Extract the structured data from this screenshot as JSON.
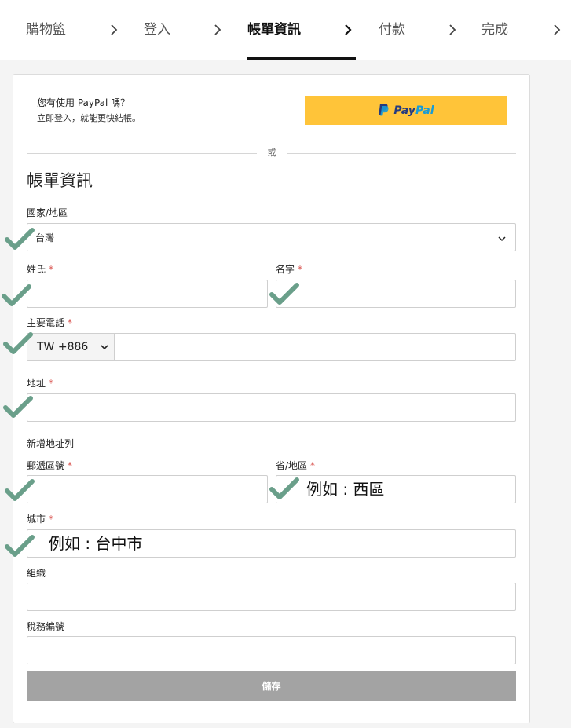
{
  "steps": [
    {
      "label": "購物籃",
      "active": false
    },
    {
      "label": "登入",
      "active": false
    },
    {
      "label": "帳單資訊",
      "active": true
    },
    {
      "label": "付款",
      "active": false
    },
    {
      "label": "完成",
      "active": false
    }
  ],
  "paypal": {
    "question": "您有使用 PayPal 嗎？",
    "subtitle": "立即登入，就能更快結帳。",
    "button_pay": "Pay",
    "button_pal": "Pal"
  },
  "divider_text": "或",
  "form": {
    "title": "帳單資訊",
    "country_label": "國家/地區",
    "country_value": "台灣",
    "last_name_label": "姓氏",
    "first_name_label": "名字",
    "phone_label": "主要電話",
    "phone_prefix": "TW +886",
    "address_label": "地址",
    "add_address_line": "新增地址列",
    "postal_label": "郵遞區號",
    "state_label": "省/地區",
    "state_placeholder": "例如 : 西區",
    "city_label": "城市",
    "city_placeholder": "例如 : 台中市",
    "org_label": "組織",
    "tax_label": "稅務編號",
    "required_mark": "*",
    "save_label": "儲存"
  },
  "colors": {
    "paypal_yellow": "#ffc439",
    "paypal_dark_blue": "#253b80",
    "paypal_light_blue": "#179bd7",
    "required_red": "#d9534f",
    "check_green": "#6a9f8a",
    "save_disabled": "#a3a3a3"
  }
}
